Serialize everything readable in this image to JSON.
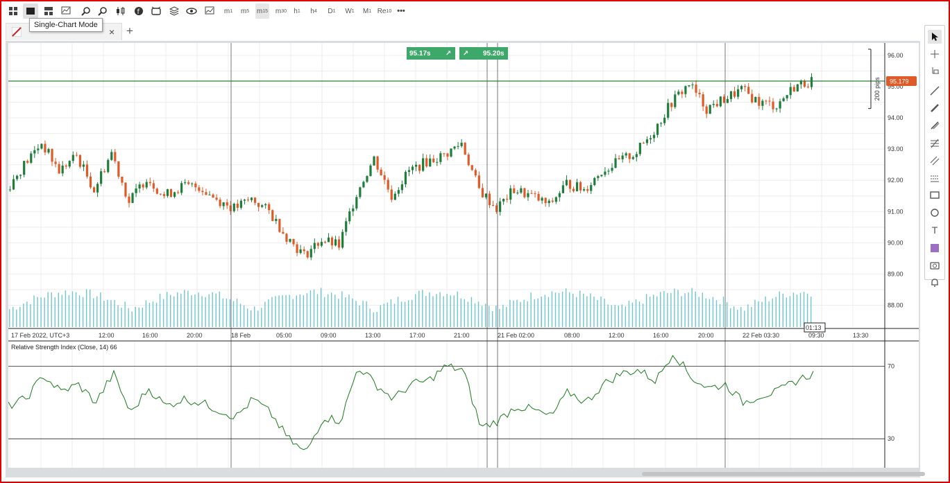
{
  "toolbar": {
    "timeframes": [
      {
        "label": "m",
        "sub": "1"
      },
      {
        "label": "m",
        "sub": "5"
      },
      {
        "label": "m",
        "sub": "15"
      },
      {
        "label": "m",
        "sub": "30"
      },
      {
        "label": "h",
        "sub": "1"
      },
      {
        "label": "h",
        "sub": "4"
      },
      {
        "label": "D",
        "sub": "1"
      },
      {
        "label": "W",
        "sub": "1"
      },
      {
        "label": "M",
        "sub": "1"
      },
      {
        "label": "Re",
        "sub": "10"
      }
    ],
    "active_timeframe": 2,
    "more_label": "•••"
  },
  "tooltip": {
    "text": "Single-Chart Mode"
  },
  "tab": {
    "close": "×",
    "add": "+"
  },
  "trade": {
    "sell_price": "95.17s",
    "buy_price": "95.20s",
    "sell_arrow": "↗",
    "buy_arrow": "↗"
  },
  "price_axis": {
    "labels": [
      "96.00",
      "95.00",
      "94.00",
      "93.00",
      "92.00",
      "91.00",
      "90.00",
      "89.00",
      "88.00"
    ],
    "current_price": "95.179",
    "pips_label": "200 pips"
  },
  "time_axis": {
    "labels": [
      "17 Feb 2022, UTC+3",
      "12:00",
      "16:00",
      "20:00",
      "18 Feb",
      "05:00",
      "09:00",
      "13:00",
      "17:00",
      "21:00",
      "21 Feb 02:00",
      "08:00",
      "12:00",
      "16:00",
      "20:00",
      "22 Feb 03:30",
      "09:30",
      "13:30"
    ],
    "cursor_time": "01:13"
  },
  "rsi": {
    "title": "Relative Strength Index (Close, 14) 66",
    "levels": [
      "70",
      "30"
    ]
  },
  "colors": {
    "bull": "#1e7d3b",
    "bear": "#e05a28",
    "volume": "#6ec6cf",
    "price_line": "#e05a28",
    "rsi_line": "#1a7a1a",
    "badge": "#3ea76a"
  },
  "chart_data": {
    "type": "line",
    "title": "",
    "x": [
      0,
      5,
      10,
      15,
      20,
      25,
      30,
      35,
      40,
      45,
      50,
      55,
      60,
      65,
      70,
      75,
      80,
      85,
      90,
      95,
      100,
      105,
      110,
      115,
      120,
      125,
      130,
      135,
      140,
      145,
      150,
      155,
      160,
      165,
      170,
      175,
      180,
      185,
      190,
      195,
      200,
      205,
      210,
      215,
      220,
      225,
      230
    ],
    "series": [
      {
        "name": "Close",
        "values": [
          91.7,
          92.5,
          93.2,
          92.3,
          92.8,
          91.7,
          92.9,
          91.3,
          92.1,
          91.5,
          91.8,
          91.8,
          91.4,
          91.1,
          91.4,
          91.0,
          90.2,
          89.6,
          90.1,
          89.9,
          91.6,
          92.7,
          91.5,
          92.3,
          92.6,
          92.8,
          93.2,
          91.7,
          91.1,
          91.7,
          91.5,
          91.2,
          91.9,
          91.7,
          92.3,
          92.6,
          92.9,
          93.6,
          94.5,
          95.1,
          94.3,
          94.6,
          94.9,
          94.5,
          94.4,
          95.0,
          95.2
        ]
      },
      {
        "name": "RSI",
        "values": [
          48,
          52,
          65,
          56,
          60,
          50,
          66,
          44,
          58,
          48,
          52,
          50,
          46,
          42,
          52,
          44,
          30,
          22,
          42,
          40,
          70,
          60,
          52,
          60,
          62,
          70,
          68,
          36,
          40,
          48,
          46,
          42,
          56,
          50,
          60,
          66,
          68,
          62,
          78,
          64,
          58,
          60,
          50,
          54,
          56,
          62,
          66
        ]
      }
    ],
    "ylim_price": [
      87.3,
      96.4
    ],
    "ylim_rsi": [
      14,
      84
    ],
    "current_price": 95.179
  }
}
